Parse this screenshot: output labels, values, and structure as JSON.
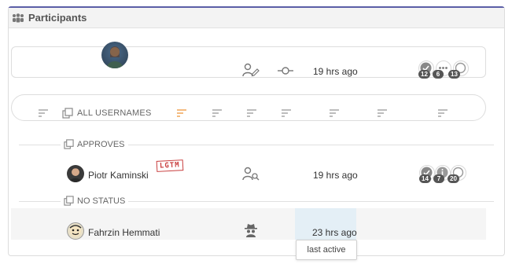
{
  "panel": {
    "title": "Participants",
    "icon": "users-icon"
  },
  "author": {
    "time": "19 hrs ago",
    "reviews": {
      "approved": "12",
      "comments": "6",
      "other": "13"
    }
  },
  "filter_bar": {
    "all_usernames": "ALL USERNAMES"
  },
  "sections": {
    "approves": {
      "label": "APPROVES",
      "participant": {
        "name": "Piotr Kaminski",
        "stamp": "LGTM",
        "time": "19 hrs ago",
        "reviews": {
          "approved": "14",
          "count": "7",
          "other": "20"
        }
      }
    },
    "no_status": {
      "label": "NO STATUS",
      "participant": {
        "name": "Fahrzin Hemmati",
        "time": "23 hrs ago",
        "tooltip": "last active"
      }
    }
  },
  "colors": {
    "accent": "#5b5ea6",
    "sort_active": "#f0a04b",
    "lgtm": "#c94040"
  }
}
